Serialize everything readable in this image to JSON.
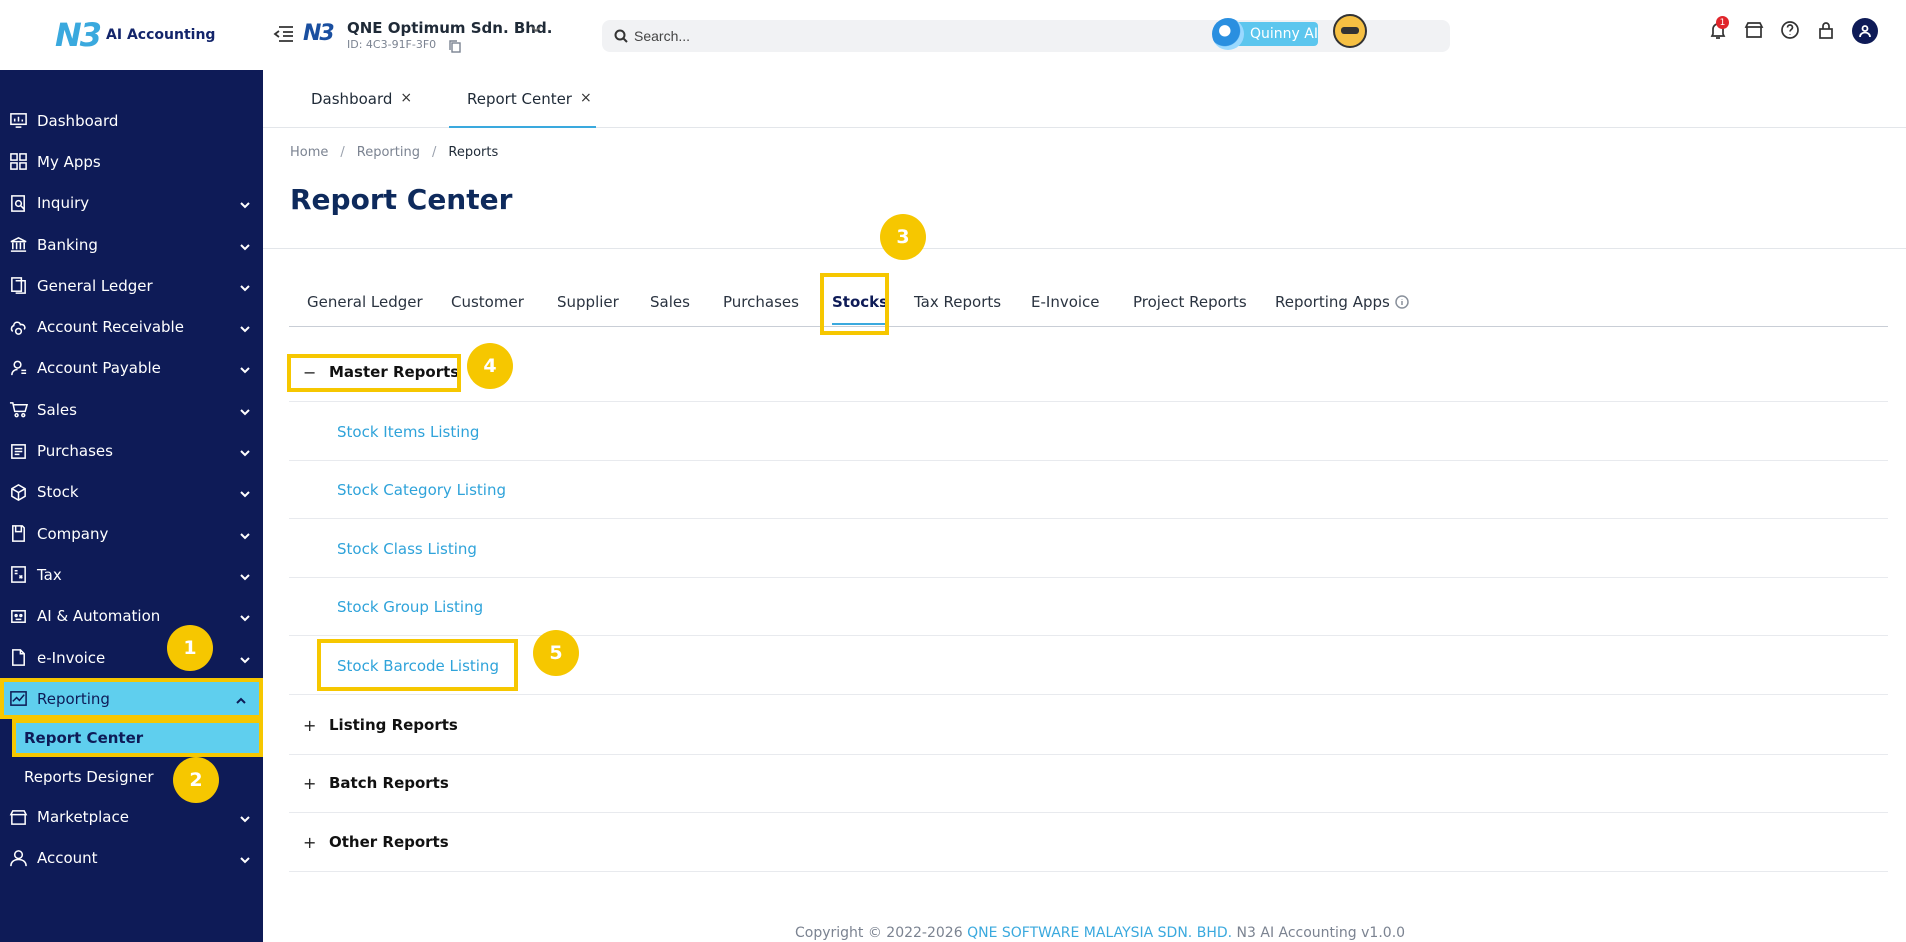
{
  "app": {
    "logo_mark": "N3",
    "logo_text": "AI Accounting"
  },
  "sidebar": {
    "items": [
      {
        "label": "Dashboard",
        "icon": "dashboard-icon"
      },
      {
        "label": "My Apps",
        "icon": "grid-icon"
      },
      {
        "label": "Inquiry",
        "icon": "inquiry-icon"
      },
      {
        "label": "Banking",
        "icon": "bank-icon"
      },
      {
        "label": "General Ledger",
        "icon": "ledger-icon"
      },
      {
        "label": "Account Receivable",
        "icon": "receivable-icon"
      },
      {
        "label": "Account Payable",
        "icon": "payable-icon"
      },
      {
        "label": "Sales",
        "icon": "cart-icon"
      },
      {
        "label": "Purchases",
        "icon": "purchases-icon"
      },
      {
        "label": "Stock",
        "icon": "box-icon"
      },
      {
        "label": "Company",
        "icon": "company-icon"
      },
      {
        "label": "Tax",
        "icon": "tax-icon"
      },
      {
        "label": "AI & Automation",
        "icon": "robot-icon"
      },
      {
        "label": "e-Invoice",
        "icon": "document-icon"
      },
      {
        "label": "Reporting",
        "icon": "chart-icon"
      },
      {
        "label": "Marketplace",
        "icon": "store-icon"
      },
      {
        "label": "Account",
        "icon": "user-icon"
      }
    ],
    "reporting_sub": [
      "Report Center",
      "Reports Designer"
    ]
  },
  "header": {
    "company_name": "QNE Optimum Sdn. Bhd.",
    "company_id": "ID: 4C3-91F-3F0",
    "search_placeholder": "Search...",
    "assistant_label": "Quinny AI",
    "notification_count": "1"
  },
  "page_tabs": [
    {
      "label": "Dashboard",
      "close": "×"
    },
    {
      "label": "Report Center",
      "close": "×"
    }
  ],
  "breadcrumb": {
    "home": "Home",
    "reporting": "Reporting",
    "current": "Reports",
    "sep": "/"
  },
  "page_title": "Report Center",
  "report_tabs": [
    "General Ledger",
    "Customer",
    "Supplier",
    "Sales",
    "Purchases",
    "Stocks",
    "Tax Reports",
    "E-Invoice",
    "Project Reports",
    "Reporting Apps"
  ],
  "active_report_tab": "Stocks",
  "sections": {
    "master": {
      "title": "Master Reports",
      "toggle": "−"
    },
    "listing": {
      "title": "Listing Reports",
      "toggle": "+"
    },
    "batch": {
      "title": "Batch Reports",
      "toggle": "+"
    },
    "other": {
      "title": "Other Reports",
      "toggle": "+"
    }
  },
  "master_reports": [
    "Stock Items Listing",
    "Stock Category Listing",
    "Stock Class Listing",
    "Stock Group Listing",
    "Stock Barcode Listing"
  ],
  "callouts": [
    "1",
    "2",
    "3",
    "4",
    "5"
  ],
  "footer": {
    "prefix": "Copyright © 2022-2026",
    "company_link": "QNE SOFTWARE MALAYSIA SDN. BHD.",
    "suffix": "N3 AI Accounting v1.0.0"
  },
  "colors": {
    "sidebar_bg": "#0e1b57",
    "accent": "#3aa9de",
    "highlight": "#f6c700",
    "active_item": "#5fcfee"
  }
}
